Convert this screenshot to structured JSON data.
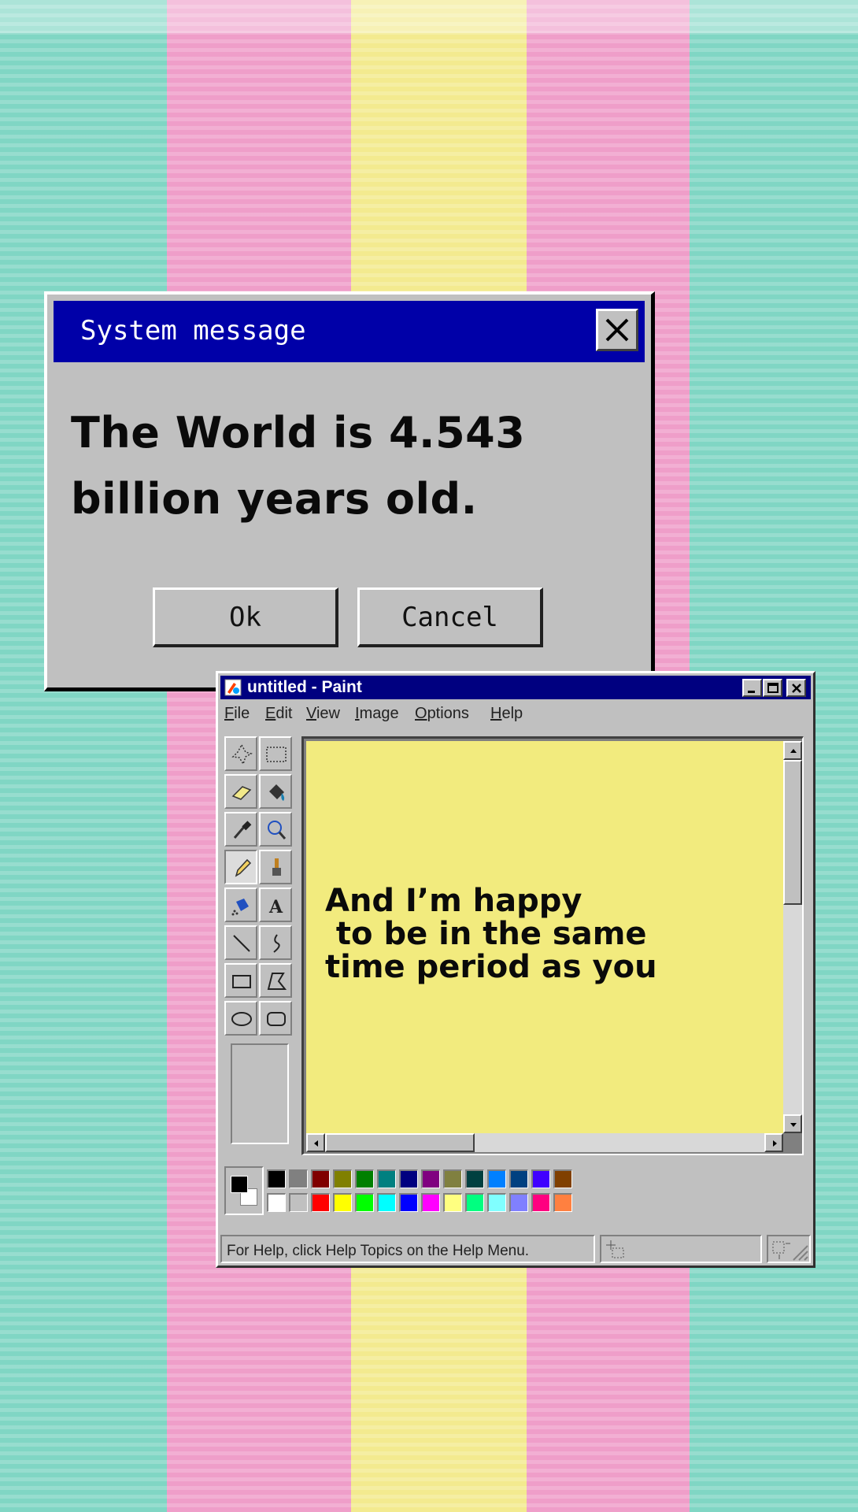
{
  "dialog": {
    "title": "System message",
    "message": "The World is 4.543 billion years old.",
    "ok_label": "Ok",
    "cancel_label": "Cancel",
    "close_icon": "close-icon"
  },
  "paint": {
    "title": "untitled - Paint",
    "menu": [
      {
        "label": "File",
        "key": "F",
        "rest": "ile"
      },
      {
        "label": "Edit",
        "key": "E",
        "rest": "dit"
      },
      {
        "label": "View",
        "key": "V",
        "rest": "iew"
      },
      {
        "label": "Image",
        "key": "I",
        "rest": "mage"
      },
      {
        "label": "Options",
        "key": "O",
        "rest": "ptions"
      },
      {
        "label": "Help",
        "key": "H",
        "rest": "elp"
      }
    ],
    "tools": [
      "free-form-select-icon",
      "select-icon",
      "eraser-icon",
      "fill-icon",
      "color-picker-icon",
      "magnifier-icon",
      "pencil-icon",
      "brush-icon",
      "airbrush-icon",
      "text-icon",
      "line-icon",
      "curve-icon",
      "rectangle-icon",
      "polygon-icon",
      "ellipse-icon",
      "rounded-rectangle-icon"
    ],
    "selected_tool": "pencil-icon",
    "canvas_text": "And I’m happy\n to be in the same\ntime period as you",
    "canvas_color": "#f2eb7e",
    "status_text": "For Help, click Help Topics on the Help Menu.",
    "foreground_color": "#000000",
    "background_color": "#ffffff",
    "palette_top": [
      "#000000",
      "#808080",
      "#800000",
      "#808000",
      "#008000",
      "#008080",
      "#000080",
      "#800080",
      "#808040",
      "#004040",
      "#0080ff",
      "#004080",
      "#4000ff",
      "#804000"
    ],
    "palette_bottom": [
      "#ffffff",
      "#c0c0c0",
      "#ff0000",
      "#ffff00",
      "#00ff00",
      "#00ffff",
      "#0000ff",
      "#ff00ff",
      "#ffff80",
      "#00ff80",
      "#80ffff",
      "#8080ff",
      "#ff0080",
      "#ff8040"
    ]
  },
  "background": {
    "stripe_colors": [
      "#80d6c4",
      "#ef9ec9",
      "#f3ea8f",
      "#ef9ec9",
      "#80d6c4"
    ]
  }
}
